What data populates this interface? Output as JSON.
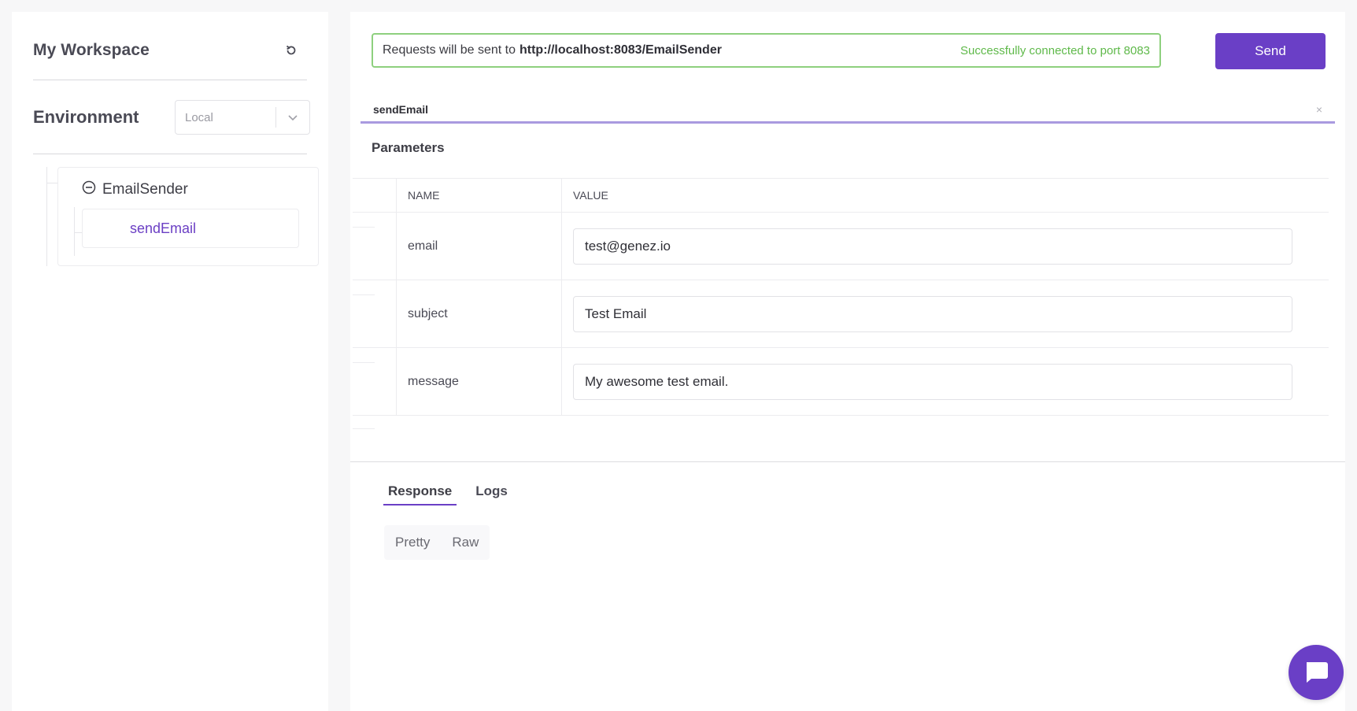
{
  "sidebar": {
    "workspace_title": "My Workspace",
    "environment_label": "Environment",
    "environment_value": "Local",
    "tree": {
      "root_label": "EmailSender",
      "child_label": "sendEmail"
    }
  },
  "main": {
    "url_bar": {
      "prefix": "Requests will be sent to",
      "address": "http://localhost:8083/EmailSender",
      "status": "Successfully connected to port 8083"
    },
    "send_label": "Send",
    "method_tab": "sendEmail",
    "close_glyph": "×",
    "params_title": "Parameters",
    "table": {
      "headers": [
        "NAME",
        "VALUE"
      ],
      "rows": [
        {
          "name": "email",
          "value": "test@genez.io"
        },
        {
          "name": "subject",
          "value": "Test Email"
        },
        {
          "name": "message",
          "value": "My awesome test email."
        }
      ]
    },
    "response_tabs": [
      "Response",
      "Logs"
    ],
    "view_modes": [
      "Pretty",
      "Raw"
    ]
  },
  "colors": {
    "accent": "#6a3fc6",
    "success": "#5fb94a",
    "success_border": "#8ed07e"
  },
  "icons": {
    "refresh": "refresh-icon",
    "chevron": "chevron-down-icon",
    "collapse": "minus-circle-icon",
    "chat": "chat-icon"
  }
}
